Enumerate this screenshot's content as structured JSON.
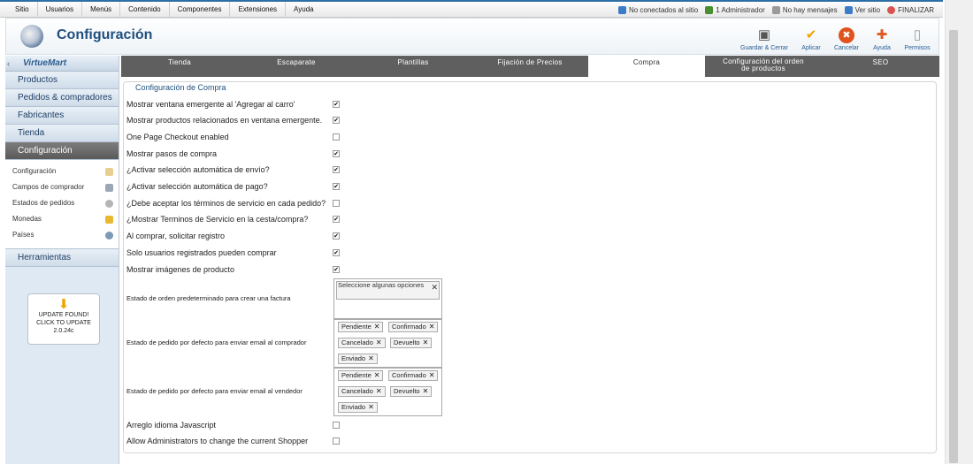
{
  "topmenu": {
    "items": [
      "Sitio",
      "Usuarios",
      "Menús",
      "Contenido",
      "Componentes",
      "Extensiones",
      "Ayuda"
    ],
    "links": [
      {
        "label": "No conectados al sitio",
        "icon": "users-icon",
        "color": "#3b7dc4"
      },
      {
        "label": "1 Administrador",
        "icon": "user-icon",
        "color": "#4a8f2f"
      },
      {
        "label": "No hay mensajes",
        "icon": "mail-icon",
        "color": "#7a7a7a"
      },
      {
        "label": "Ver sitio",
        "icon": "monitor-icon",
        "color": "#3b7dc4"
      },
      {
        "label": "FINALIZAR",
        "icon": "power-icon",
        "color": "#d9534f"
      }
    ]
  },
  "header": {
    "title": "Configuración"
  },
  "toolbar": [
    {
      "label": "Guardar & Cerrar",
      "icon": "save-icon",
      "glyph": "💾",
      "color": "#555555"
    },
    {
      "label": "Aplicar",
      "icon": "check-icon",
      "glyph": "✔",
      "color": "#f0a300"
    },
    {
      "label": "Cancelar",
      "icon": "cancel-icon",
      "glyph": "✖",
      "color": "#e0521e"
    },
    {
      "label": "Ayuda",
      "icon": "help-icon",
      "glyph": "✚",
      "color": "#e05a1e"
    },
    {
      "label": "Permisos",
      "icon": "lock-icon",
      "glyph": "🔒",
      "color": "#888888"
    }
  ],
  "sidebar": {
    "logo": "VirtueMart",
    "items": [
      "Productos",
      "Pedidos & compradores",
      "Fabricantes",
      "Tienda",
      "Configuración"
    ],
    "subitems": [
      {
        "label": "Configuración",
        "icon": "tools-icon",
        "color": "#e0c080"
      },
      {
        "label": "Campos de comprador",
        "icon": "form-icon",
        "color": "#9aa8b6"
      },
      {
        "label": "Estados de pedidos",
        "icon": "status-icon",
        "color": "#a9a9a9"
      },
      {
        "label": "Monedas",
        "icon": "coins-icon",
        "color": "#e8b830"
      },
      {
        "label": "Países",
        "icon": "globe-icon",
        "color": "#7a9ab8"
      }
    ],
    "tools_label": "Herramientas",
    "update": {
      "line1": "UPDATE FOUND!",
      "line2": "CLICK TO UPDATE",
      "version": "2.0.24c"
    }
  },
  "tabs": [
    "Tienda",
    "Escaparate",
    "Plantillas",
    "Fijación de Precios",
    "Compra",
    "Configuración del orden de productos",
    "SEO"
  ],
  "active_tab": "Compra",
  "section_title": "Configuración de Compra",
  "options": [
    {
      "label": "Mostrar ventana emergente al 'Agregar al carro'",
      "checked": true
    },
    {
      "label": "Mostrar productos relacionados en ventana emergente.",
      "checked": true
    },
    {
      "label": "One Page Checkout enabled",
      "checked": false
    },
    {
      "label": "Mostrar pasos de compra",
      "checked": true
    },
    {
      "label": "¿Activar selección automática de envío?",
      "checked": true
    },
    {
      "label": "¿Activar selección automática de pago?",
      "checked": true
    },
    {
      "label": "¿Debe aceptar los términos de servicio en cada pedido?",
      "checked": false
    },
    {
      "label": "¿Mostrar Terminos de Servicio en la cesta/compra?",
      "checked": true
    },
    {
      "label": "Al comprar, solicitar registro",
      "checked": true
    },
    {
      "label": "Solo usuarios registrados pueden comprar",
      "checked": true
    },
    {
      "label": "Mostrar imágenes de producto",
      "checked": true
    }
  ],
  "invoice": {
    "label": "Estado de orden predeterminado para crear una factura",
    "placeholder": "Seleccione algunas opciones"
  },
  "email_shopper": {
    "label": "Estado de pedido por defecto para enviar email al comprador",
    "tags": [
      "Pendiente",
      "Confirmado",
      "Cancelado",
      "Devuelto",
      "Enviado"
    ]
  },
  "email_vendor": {
    "label": "Estado de pedido por defecto para enviar email al vendedor",
    "tags": [
      "Pendiente",
      "Confirmado",
      "Cancelado",
      "Devuelto",
      "Enviado"
    ]
  },
  "bottom_options": [
    {
      "label": "Arreglo idioma Javascript",
      "checked": false
    },
    {
      "label": "Allow Administrators to change the current Shopper",
      "checked": false
    }
  ]
}
